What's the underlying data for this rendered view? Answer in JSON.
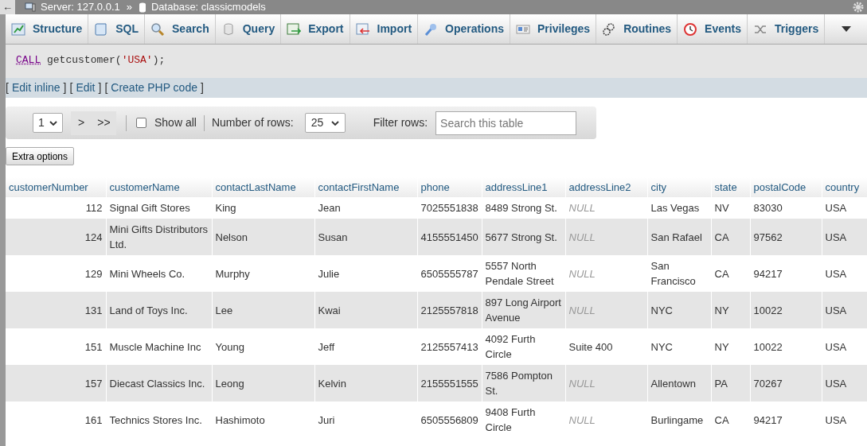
{
  "breadcrumb": {
    "back": "←",
    "server": "Server: 127.0.0.1",
    "separator": "»",
    "database": "Database: classicmodels"
  },
  "tabs": [
    {
      "label": "Structure",
      "kind": "structure",
      "selected": false
    },
    {
      "label": "SQL",
      "kind": "sql",
      "selected": false
    },
    {
      "label": "Search",
      "kind": "search",
      "selected": false
    },
    {
      "label": "Query",
      "kind": "query",
      "selected": false
    },
    {
      "label": "Export",
      "kind": "export",
      "selected": false
    },
    {
      "label": "Import",
      "kind": "import",
      "selected": false
    },
    {
      "label": "Operations",
      "kind": "operations",
      "selected": false
    },
    {
      "label": "Privileges",
      "kind": "privileges",
      "selected": false
    },
    {
      "label": "Routines",
      "kind": "routines",
      "selected": false
    },
    {
      "label": "Events",
      "kind": "events",
      "selected": false
    },
    {
      "label": "Triggers",
      "kind": "triggers",
      "selected": false
    }
  ],
  "query": {
    "keyword": "CALL",
    "name": " getcustomer(",
    "arg": "'USA'",
    "end": ");"
  },
  "query_links": [
    {
      "open": "[",
      "label": "Edit inline",
      "close": "]"
    },
    {
      "open": "[",
      "label": "Edit",
      "close": "]"
    },
    {
      "open": "[",
      "label": "Create PHP code",
      "close": "]"
    }
  ],
  "navigation": {
    "page": "1",
    "next": ">",
    "last": ">>",
    "show_all": {
      "label": "Show all",
      "checked": false
    },
    "rows_label": "Number of rows:",
    "rows_value": "25",
    "filter_label": "Filter rows:",
    "filter_placeholder": "Search this table"
  },
  "extra_options": "Extra options",
  "table": {
    "columns": [
      "customerNumber",
      "customerName",
      "contactLastName",
      "contactFirstName",
      "phone",
      "addressLine1",
      "addressLine2",
      "city",
      "state",
      "postalCode",
      "country"
    ],
    "rows": [
      [
        "112",
        "Signal Gift Stores",
        "King",
        "Jean",
        "7025551838",
        "8489 Strong St.",
        {
          "text": "NULL",
          "null": true
        },
        "Las Vegas",
        "NV",
        "83030",
        "USA"
      ],
      [
        "124",
        "Mini Gifts Distributors Ltd.",
        "Nelson",
        "Susan",
        "4155551450",
        "5677 Strong St.",
        {
          "text": "NULL",
          "null": true
        },
        "San Rafael",
        "CA",
        "97562",
        "USA"
      ],
      [
        "129",
        "Mini Wheels Co.",
        "Murphy",
        "Julie",
        "6505555787",
        "5557 North Pendale Street",
        {
          "text": "NULL",
          "null": true
        },
        "San Francisco",
        "CA",
        "94217",
        "USA"
      ],
      [
        "131",
        "Land of Toys Inc.",
        "Lee",
        "Kwai",
        "2125557818",
        "897 Long Airport Avenue",
        {
          "text": "NULL",
          "null": true
        },
        "NYC",
        "NY",
        "10022",
        "USA"
      ],
      [
        "151",
        "Muscle Machine Inc",
        "Young",
        "Jeff",
        "2125557413",
        "4092 Furth Circle",
        "Suite 400",
        "NYC",
        "NY",
        "10022",
        "USA"
      ],
      [
        "157",
        "Diecast Classics Inc.",
        "Leong",
        "Kelvin",
        "2155551555",
        "7586 Pompton St.",
        {
          "text": "NULL",
          "null": true
        },
        "Allentown",
        "PA",
        "70267",
        "USA"
      ],
      [
        "161",
        "Technics Stores Inc.",
        "Hashimoto",
        "Juri",
        "6505556809",
        "9408 Furth Circle",
        {
          "text": "NULL",
          "null": true
        },
        "Burlingame",
        "CA",
        "94217",
        "USA"
      ]
    ]
  }
}
